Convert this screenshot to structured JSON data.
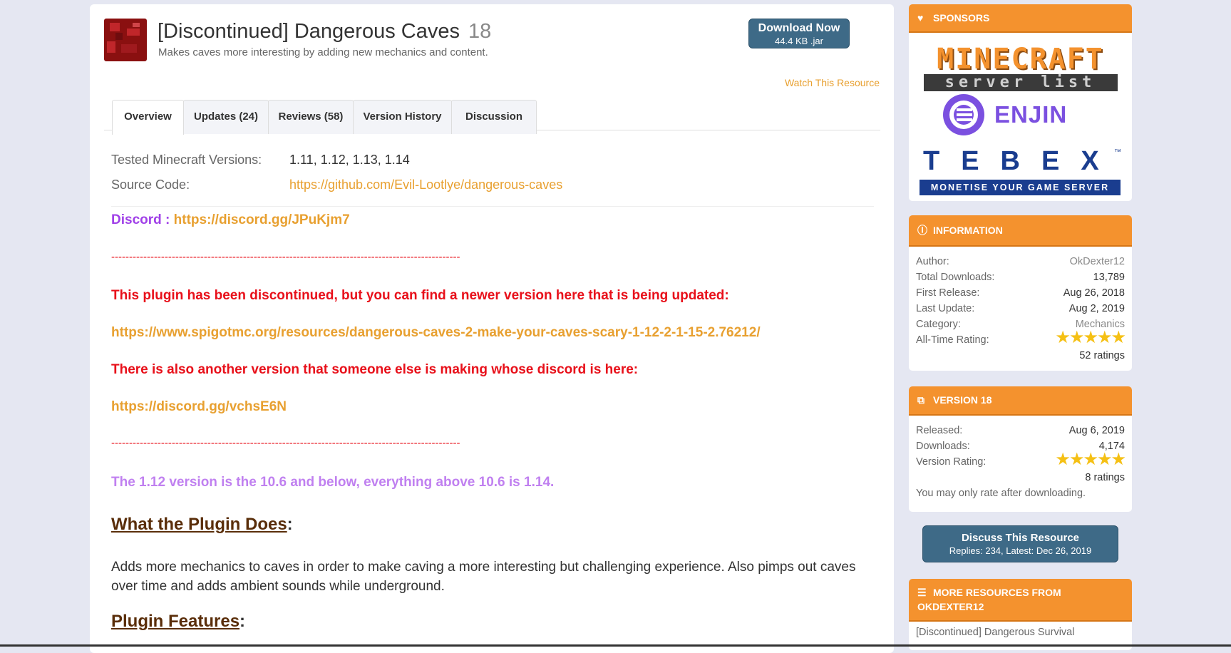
{
  "resource": {
    "title": "[Discontinued] Dangerous Caves",
    "version": "18",
    "tagline": "Makes caves more interesting by adding new mechanics and content.",
    "download": {
      "label": "Download Now",
      "sub": "44.4 KB .jar"
    },
    "watch_label": "Watch This Resource"
  },
  "tabs": [
    "Overview",
    "Updates (24)",
    "Reviews (58)",
    "Version History",
    "Discussion"
  ],
  "meta": {
    "tested_label": "Tested Minecraft Versions:",
    "tested_value": "1.11, 1.12, 1.13, 1.14",
    "source_label": "Source Code:",
    "source_value": "https://github.com/Evil-Lootlye/dangerous-caves"
  },
  "body": {
    "discord_label": "Discord :",
    "discord_link": "https://discord.gg/JPuKjm7",
    "dashes": "--------------------------------------------------------------------------------------------------",
    "discontinued_notice": "This plugin has been discontinued, but you can find a newer version here that is being updated:",
    "new_version_link": "https://www.spigotmc.org/resources/dangerous-caves-2-make-your-caves-scary-1-12-2-1-15-2.76212/",
    "other_version_notice": "There is also another version that someone else is making whose discord is here:",
    "other_discord_link": "https://discord.gg/vchsE6N",
    "version_note": "The 1.12 version is the 10.6 and below, everything above 10.6 is 1.14.",
    "heading_what": "What the Plugin Does",
    "description": "Adds more mechanics to caves in order to make caving a more interesting but challenging experience. Also pimps out caves over time and adds ambient sounds while underground.",
    "heading_features": "Plugin Features"
  },
  "sidebar": {
    "sponsors": {
      "title": "Sponsors",
      "mc_line1": "MINECRAFT",
      "mc_line2": "server list",
      "enjin": "ENJIN",
      "tebex": "TEBEX",
      "tebex_tm": "™",
      "tebex_sub": "MONETISE YOUR GAME SERVER"
    },
    "information": {
      "title": "Information",
      "rows": [
        {
          "k": "Author:",
          "v": "OkDexter12"
        },
        {
          "k": "Total Downloads:",
          "v": "13,789"
        },
        {
          "k": "First Release:",
          "v": "Aug 26, 2018"
        },
        {
          "k": "Last Update:",
          "v": "Aug 2, 2019"
        },
        {
          "k": "Category:",
          "v": "Mechanics"
        }
      ],
      "rating_label": "All-Time Rating:",
      "rating_value": 5,
      "ratings_count": "52 ratings"
    },
    "version": {
      "title": "Version 18",
      "rows": [
        {
          "k": "Released:",
          "v": "Aug 6, 2019"
        },
        {
          "k": "Downloads:",
          "v": "4,174"
        }
      ],
      "rating_label": "Version Rating:",
      "rating_value": 5,
      "ratings_count": "8 ratings",
      "note": "You may only rate after downloading."
    },
    "discuss": {
      "label": "Discuss This Resource",
      "sub": "Replies: 234, Latest: Dec 26, 2019"
    },
    "more": {
      "title_line1": "More Resources From",
      "title_line2": "OkDexter12",
      "first_item": "[Discontinued] Dangerous Survival"
    }
  },
  "colors": {
    "accent": "#f4922e",
    "button": "#3e6a87",
    "link": "#e8a030",
    "alert": "#e8101a"
  }
}
